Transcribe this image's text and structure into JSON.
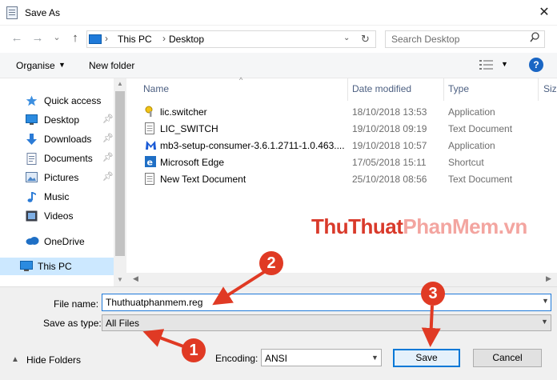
{
  "window": {
    "title": "Save As",
    "close": "✕"
  },
  "nav": {
    "back": "←",
    "forward": "→",
    "up_dd": "⌄",
    "up": "↑",
    "address_segments": [
      "This PC",
      "Desktop"
    ],
    "address_sep": "›",
    "address_dropdown": "⌄",
    "refresh": "↻"
  },
  "search": {
    "placeholder": "Search Desktop"
  },
  "toolbar": {
    "organise": "Organise",
    "new_folder": "New folder"
  },
  "sidebar": {
    "items": [
      {
        "label": "Quick access",
        "icon": "star-icon"
      },
      {
        "label": "Desktop",
        "icon": "desktop-icon",
        "pinned": true
      },
      {
        "label": "Downloads",
        "icon": "downloads-icon",
        "pinned": true
      },
      {
        "label": "Documents",
        "icon": "documents-icon",
        "pinned": true
      },
      {
        "label": "Pictures",
        "icon": "pictures-icon",
        "pinned": true
      },
      {
        "label": "Music",
        "icon": "music-icon"
      },
      {
        "label": "Videos",
        "icon": "videos-icon"
      },
      {
        "label": "OneDrive",
        "icon": "onedrive-icon"
      },
      {
        "label": "This PC",
        "icon": "this-pc-icon",
        "selected": true
      }
    ]
  },
  "filelist": {
    "columns": [
      "Name",
      "Date modified",
      "Type",
      "Siz"
    ],
    "rows": [
      {
        "name": "lic.switcher",
        "date": "18/10/2018 13:53",
        "type": "Application",
        "icon": "app-key-icon"
      },
      {
        "name": "LIC_SWITCH",
        "date": "19/10/2018 09:19",
        "type": "Text Document",
        "icon": "text-document-icon"
      },
      {
        "name": "mb3-setup-consumer-3.6.1.2711-1.0.463....",
        "date": "19/10/2018 10:57",
        "type": "Application",
        "icon": "malwarebytes-icon"
      },
      {
        "name": "Microsoft Edge",
        "date": "17/05/2018 15:11",
        "type": "Shortcut",
        "icon": "edge-icon"
      },
      {
        "name": "New Text Document",
        "date": "25/10/2018 08:56",
        "type": "Text Document",
        "icon": "text-document-icon"
      }
    ]
  },
  "watermark": {
    "part1": "ThuThuat",
    "part2": "PhanMem",
    "part3": ".vn"
  },
  "form": {
    "file_name_label": "File name:",
    "file_name_value": "Thuthuatphanmem.reg",
    "save_type_label": "Save as type:",
    "save_type_value": "All Files",
    "encoding_label": "Encoding:",
    "encoding_value": "ANSI"
  },
  "footer": {
    "hide_folders": "Hide Folders",
    "save": "Save",
    "cancel": "Cancel"
  },
  "callouts": [
    "1",
    "2",
    "3"
  ],
  "colors": {
    "accent": "#0078d7",
    "callout": "#e03a24",
    "selection": "#cce8ff"
  }
}
